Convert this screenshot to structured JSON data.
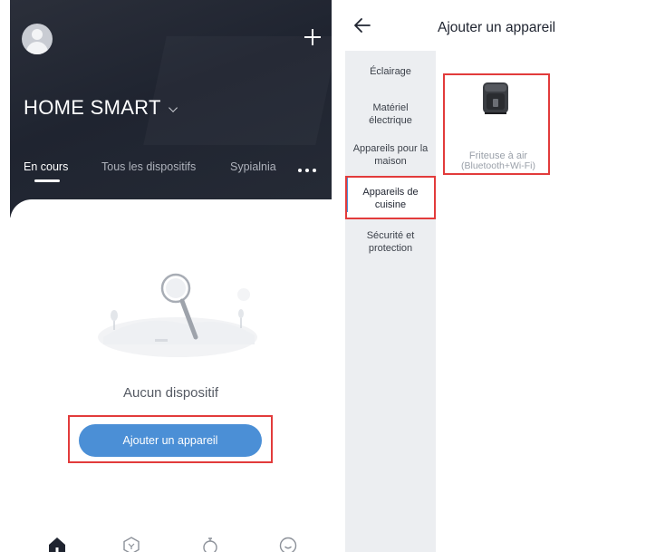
{
  "left_screen": {
    "home_name": "HOME SMART",
    "tabs": [
      {
        "label": "En cours",
        "active": true
      },
      {
        "label": "Tous les dispositifs",
        "active": false
      },
      {
        "label": "Sypialnia",
        "active": false
      }
    ],
    "empty_text": "Aucun dispositif",
    "add_button_label": "Ajouter un appareil",
    "icons": {
      "avatar": "user-avatar-icon",
      "add": "plus-icon",
      "more": "more-dots-icon",
      "nav": [
        "home-icon",
        "scene-icon",
        "automation-icon",
        "profile-icon"
      ]
    }
  },
  "right_screen": {
    "title": "Ajouter un appareil",
    "categories": [
      {
        "label": "Éclairage",
        "active": false
      },
      {
        "label": "Matériel électrique",
        "active": false
      },
      {
        "label": "Appareils pour la maison",
        "active": false
      },
      {
        "label": "Appareils de cuisine",
        "active": true
      },
      {
        "label": "Sécurité et protection",
        "active": false
      }
    ],
    "device": {
      "name": "Friteuse à air",
      "connectivity": "(Bluetooth+Wi-Fi)",
      "icon": "air-fryer-icon"
    }
  },
  "colors": {
    "accent": "#4b8fd6",
    "highlight": "#e23b3b",
    "dark_header": "#1f2430"
  }
}
